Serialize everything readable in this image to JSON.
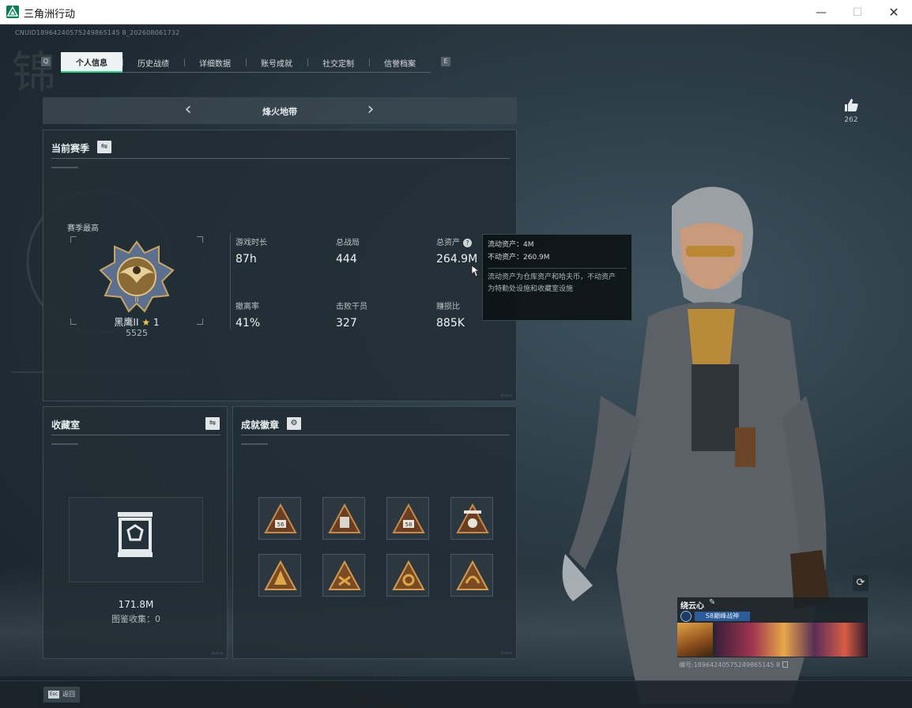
{
  "window": {
    "title": "三角洲行动",
    "min": "—",
    "max": "☐",
    "close": "✕"
  },
  "cn_uid": "CNUID18964240575249865145 8_202608061732",
  "tabs": {
    "q_key": "Q",
    "e_key": "E",
    "items": [
      {
        "label": "个人信息",
        "active": true
      },
      {
        "label": "历史战绩",
        "active": false
      },
      {
        "label": "详细数据",
        "active": false
      },
      {
        "label": "账号成就",
        "active": false
      },
      {
        "label": "社交定制",
        "active": false
      },
      {
        "label": "信誉档案",
        "active": false
      }
    ]
  },
  "mode": {
    "prev": "‹",
    "next": "›",
    "title": "烽火地带"
  },
  "season": {
    "header": "当前赛季",
    "swap_icon": "⇋",
    "best_label": "赛季最高",
    "rank_name": "黑鹰II",
    "rank_star": "★",
    "rank_level": "1",
    "rank_score": "5525",
    "stats": [
      {
        "label": "游戏时长",
        "value": "87h"
      },
      {
        "label": "总战局",
        "value": "444"
      },
      {
        "label": "总资产",
        "value": "264.9M"
      },
      {
        "label": "撤离率",
        "value": "41%"
      },
      {
        "label": "击败干员",
        "value": "327"
      },
      {
        "label": "赚损比",
        "value": "885K"
      }
    ],
    "help_icon": "?"
  },
  "tooltip": {
    "liquid_label": "流动资产：",
    "liquid_value": "4M",
    "fixed_label": "不动资产：",
    "fixed_value": "260.9M",
    "desc_line1": "流动资产为仓库资产和哈夫币，不动资产",
    "desc_line2": "为特勤处设施和收藏室设施"
  },
  "collection": {
    "header": "收藏室",
    "swap_icon": "⇋",
    "value": "171.8M",
    "collected": "图鉴收集：0"
  },
  "achievements": {
    "header": "成就徽章",
    "settings_icon": "⚙",
    "badges": [
      {
        "name": "badge-1",
        "label": "56"
      },
      {
        "name": "badge-2",
        "label": ""
      },
      {
        "name": "badge-3",
        "label": "58"
      },
      {
        "name": "badge-4",
        "label": ""
      },
      {
        "name": "badge-5",
        "label": ""
      },
      {
        "name": "badge-6",
        "label": ""
      },
      {
        "name": "badge-7",
        "label": ""
      },
      {
        "name": "badge-8",
        "label": ""
      }
    ]
  },
  "likes": {
    "count": "262",
    "icon": "thumbs-up-icon"
  },
  "player_card": {
    "name": "绕云心",
    "edit_icon": "✎",
    "tag": "S8巅峰战神",
    "id": "编号:18964240575249865145 8"
  },
  "refresh_icon": "⟳",
  "bottom": {
    "esc_key": "Esc",
    "esc_label": "返回"
  },
  "colors": {
    "accent": "#2fd08a",
    "gold": "#f3c54c",
    "bg": "#1f2b33"
  }
}
